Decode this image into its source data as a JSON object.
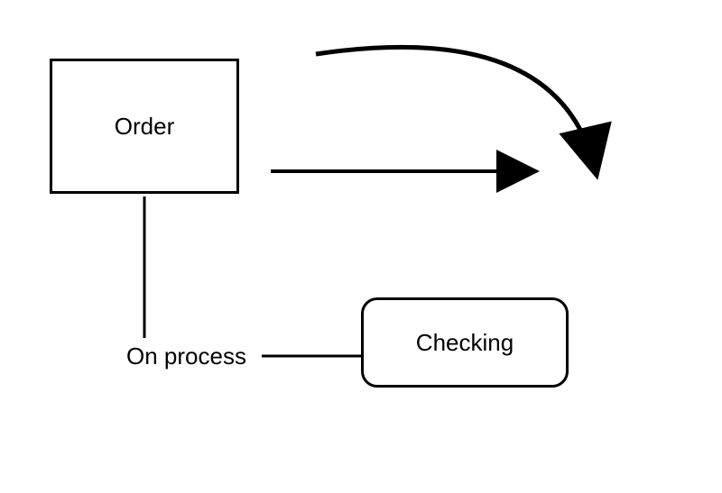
{
  "nodes": {
    "order": {
      "label": "Order"
    },
    "checking": {
      "label": "Checking"
    }
  },
  "edges": {
    "on_process": {
      "label": "On process"
    }
  },
  "diagram": {
    "type": "flowchart"
  }
}
